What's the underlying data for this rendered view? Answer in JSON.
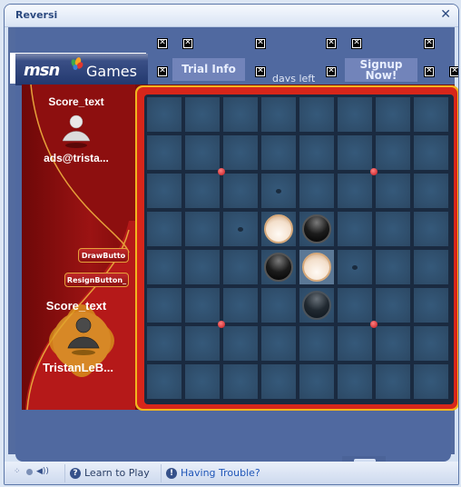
{
  "window": {
    "title": "Reversi",
    "close_label": "✕"
  },
  "header": {
    "logo_text": "msn",
    "logo_suffix": "Games",
    "trial_info_label": "Trial Info",
    "days_left_label": "days left",
    "signup_label": "Signup Now!",
    "broken_image_glyph": "✕"
  },
  "players": [
    {
      "score_text": "Score_text",
      "name": "ads@trista...",
      "role": "opponent"
    },
    {
      "score_text": "Score_text",
      "name": "TristanLeB...",
      "role": "self",
      "active": true
    }
  ],
  "controls": {
    "draw_label": "DrawButto",
    "resign_label": "ResignButton_"
  },
  "board": {
    "size": 8,
    "discs": [
      {
        "row": 3,
        "col": 3,
        "color": "white"
      },
      {
        "row": 3,
        "col": 4,
        "color": "black"
      },
      {
        "row": 4,
        "col": 3,
        "color": "black"
      },
      {
        "row": 4,
        "col": 4,
        "color": "white",
        "highlighted": true
      },
      {
        "row": 5,
        "col": 4,
        "color": "black",
        "preview": true
      }
    ],
    "hints": [
      {
        "row": 2,
        "col": 3
      },
      {
        "row": 3,
        "col": 2
      },
      {
        "row": 4,
        "col": 5
      }
    ],
    "star_points": [
      [
        2,
        2
      ],
      [
        2,
        6
      ],
      [
        6,
        2
      ],
      [
        6,
        6
      ]
    ]
  },
  "footer": {
    "learn_label": "Learn to Play",
    "trouble_label": "Having Trouble?",
    "help_glyph": "?",
    "alert_glyph": "!",
    "sound_glyph": "◀))"
  },
  "colors": {
    "board_cell": "#2e4b67",
    "frame_gold": "#f2b51f",
    "frame_red": "#d7261a",
    "sidebar_red": "#8b1010",
    "chrome_blue": "#5069a0"
  }
}
